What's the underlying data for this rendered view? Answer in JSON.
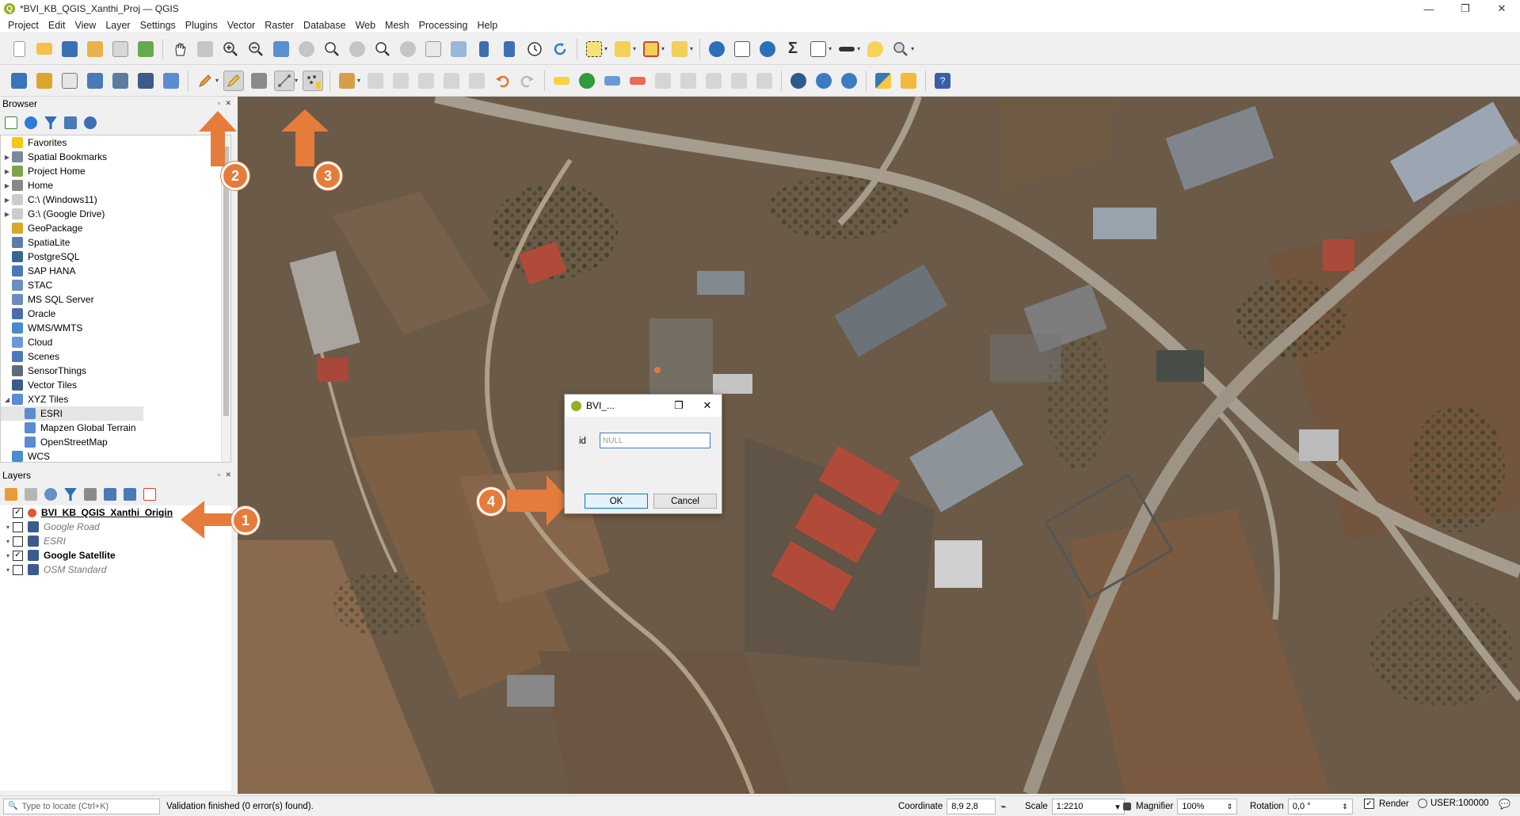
{
  "window": {
    "title": "*BVI_KB_QGIS_Xanthi_Proj — QGIS",
    "logo_letter": "Q",
    "minimize": "—",
    "maximize": "❐",
    "close": "✕"
  },
  "menu": [
    "Project",
    "Edit",
    "View",
    "Layer",
    "Settings",
    "Plugins",
    "Vector",
    "Raster",
    "Database",
    "Web",
    "Mesh",
    "Processing",
    "Help"
  ],
  "browser": {
    "title": "Browser",
    "items": [
      {
        "label": "Favorites",
        "icon": "star-icon",
        "color": "#f5c518",
        "expand": ""
      },
      {
        "label": "Spatial Bookmarks",
        "icon": "bookmark-icon",
        "color": "#7a8a9a",
        "expand": "▶"
      },
      {
        "label": "Project Home",
        "icon": "folder-icon",
        "color": "#7fa34a",
        "expand": "▶"
      },
      {
        "label": "Home",
        "icon": "home-icon",
        "color": "#888888",
        "expand": "▶"
      },
      {
        "label": "C:\\ (Windows11)",
        "icon": "folder-icon",
        "color": "#cccccc",
        "expand": "▶"
      },
      {
        "label": "G:\\ (Google Drive)",
        "icon": "folder-icon",
        "color": "#cccccc",
        "expand": "▶"
      },
      {
        "label": "GeoPackage",
        "icon": "geopackage-icon",
        "color": "#d9a62e",
        "expand": ""
      },
      {
        "label": "SpatiaLite",
        "icon": "spatialite-icon",
        "color": "#5d7aa8",
        "expand": ""
      },
      {
        "label": "PostgreSQL",
        "icon": "postgresql-icon",
        "color": "#336791",
        "expand": ""
      },
      {
        "label": "SAP HANA",
        "icon": "sap-hana-icon",
        "color": "#4a7ab5",
        "expand": ""
      },
      {
        "label": "STAC",
        "icon": "stac-icon",
        "color": "#6a8fc2",
        "expand": ""
      },
      {
        "label": "MS SQL Server",
        "icon": "mssql-icon",
        "color": "#6b8cbc",
        "expand": ""
      },
      {
        "label": "Oracle",
        "icon": "oracle-icon",
        "color": "#4a6ea8",
        "expand": ""
      },
      {
        "label": "WMS/WMTS",
        "icon": "globe-icon",
        "color": "#4a8bd0",
        "expand": ""
      },
      {
        "label": "Cloud",
        "icon": "cloud-icon",
        "color": "#6a9ad6",
        "expand": ""
      },
      {
        "label": "Scenes",
        "icon": "scenes-icon",
        "color": "#4a7ab5",
        "expand": ""
      },
      {
        "label": "SensorThings",
        "icon": "sensor-icon",
        "color": "#5c6c7c",
        "expand": ""
      },
      {
        "label": "Vector Tiles",
        "icon": "grid-icon",
        "color": "#3b5b8b",
        "expand": ""
      },
      {
        "label": "XYZ Tiles",
        "icon": "grid-icon",
        "color": "#5b8bd0",
        "expand": "◢"
      },
      {
        "label": "ESRI",
        "icon": "grid-icon",
        "color": "#5b8bd0",
        "expand": "",
        "child": true,
        "selected": true
      },
      {
        "label": "Mapzen Global Terrain",
        "icon": "grid-icon",
        "color": "#5b8bd0",
        "expand": "",
        "child": true
      },
      {
        "label": "OpenStreetMap",
        "icon": "grid-icon",
        "color": "#5b8bd0",
        "expand": "",
        "child": true
      },
      {
        "label": "WCS",
        "icon": "globe-icon",
        "color": "#4a8bd0",
        "expand": ""
      }
    ]
  },
  "layers": {
    "title": "Layers",
    "items": [
      {
        "label": "BVI_KB_QGIS_Xanthi_Origin",
        "checked": true,
        "style": "bold-underline",
        "icon": "point-layer-icon",
        "color": "#e05a2b"
      },
      {
        "label": "Google Road",
        "checked": false,
        "style": "italic",
        "icon": "raster-icon",
        "color": "#3b5b8b"
      },
      {
        "label": "ESRI",
        "checked": false,
        "style": "italic",
        "icon": "raster-icon",
        "color": "#3b5b8b"
      },
      {
        "label": "Google Satellite",
        "checked": true,
        "style": "bold",
        "icon": "raster-icon",
        "color": "#3b5b8b"
      },
      {
        "label": "OSM Standard",
        "checked": false,
        "style": "italic",
        "icon": "raster-icon",
        "color": "#3b5b8b"
      }
    ]
  },
  "dialog": {
    "title": "BVI_...",
    "field_label": "id",
    "field_value": "NULL",
    "ok": "OK",
    "cancel": "Cancel"
  },
  "annotations": [
    "1",
    "2",
    "3",
    "4"
  ],
  "annotation_color": "#e57c3c",
  "status": {
    "locate_placeholder": "Type to locate (Ctrl+K)",
    "message": "Validation finished (0 error(s) found).",
    "coordinate_label": "Coordinate",
    "coordinate_value": "8,9  2,8",
    "scale_label": "Scale",
    "scale_value": "1:2210",
    "magnifier_label": "Magnifier",
    "magnifier_value": "100%",
    "rotation_label": "Rotation",
    "rotation_value": "0,0 °",
    "render_label": "Render",
    "crs": "USER:100000"
  },
  "glyphs": {
    "dropdown": "▾",
    "check": "✓",
    "search": "🔍",
    "panel_buttons": "▫ ✕",
    "spin": "⇕",
    "message": "💬"
  }
}
